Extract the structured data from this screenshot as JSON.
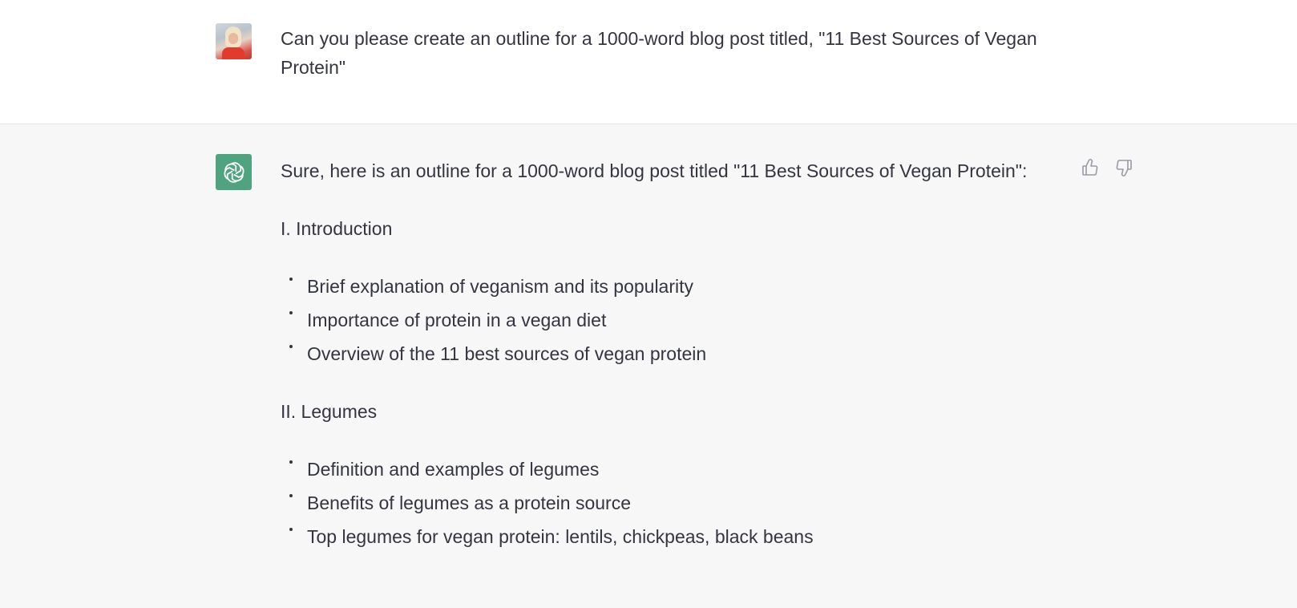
{
  "user_message": {
    "text": "Can you please create an outline for a 1000-word blog post titled, \"11 Best Sources of Vegan Protein\""
  },
  "assistant_message": {
    "intro": "Sure, here is an outline for a 1000-word blog post titled \"11 Best Sources of Vegan Protein\":",
    "sections": [
      {
        "heading": "I. Introduction",
        "bullets": [
          "Brief explanation of veganism and its popularity",
          "Importance of protein in a vegan diet",
          "Overview of the 11 best sources of vegan protein"
        ]
      },
      {
        "heading": "II. Legumes",
        "bullets": [
          "Definition and examples of legumes",
          "Benefits of legumes as a protein source",
          "Top legumes for vegan protein: lentils, chickpeas, black beans"
        ]
      }
    ]
  },
  "icons": {
    "assistant_avatar": "openai-logo-icon",
    "feedback_up": "thumbs-up-icon",
    "feedback_down": "thumbs-down-icon"
  },
  "colors": {
    "assistant_bg": "#f7f7f8",
    "assistant_avatar_bg": "#4fa37f",
    "text": "#343541"
  }
}
